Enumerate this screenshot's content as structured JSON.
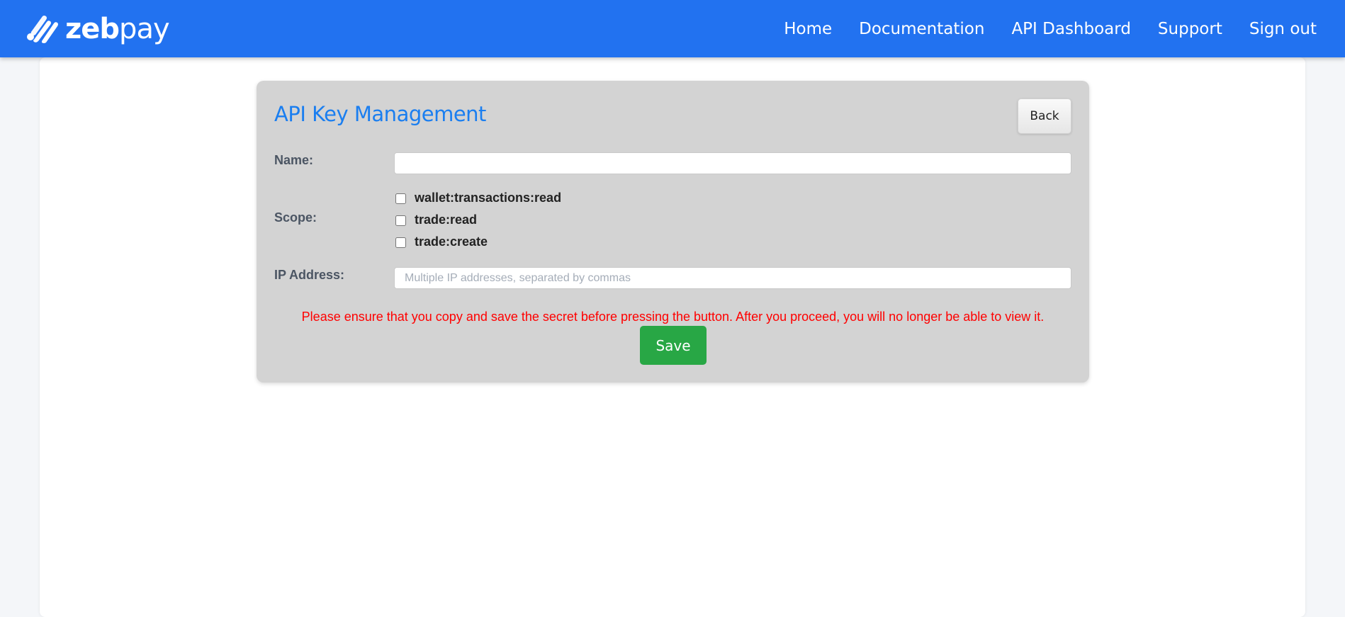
{
  "brand": {
    "name_bold": "zeb",
    "name_light": "pay",
    "logo_icon": "zebpay-stripes-icon"
  },
  "nav": {
    "items": [
      {
        "label": "Home"
      },
      {
        "label": "Documentation"
      },
      {
        "label": "API Dashboard"
      },
      {
        "label": "Support"
      },
      {
        "label": "Sign out"
      }
    ]
  },
  "card": {
    "title": "API Key Management",
    "back_label": "Back",
    "name_label": "Name:",
    "name_value": "",
    "scope_label": "Scope:",
    "scopes": [
      {
        "label": "wallet:transactions:read",
        "checked": false
      },
      {
        "label": "trade:read",
        "checked": false
      },
      {
        "label": "trade:create",
        "checked": false
      }
    ],
    "ip_label": "IP Address:",
    "ip_placeholder": "Multiple IP addresses, separated by commas",
    "warning": "Please ensure that you copy and save the secret before pressing the button. After you proceed, you will no longer be able to view it.",
    "save_label": "Save"
  },
  "colors": {
    "navbar": "#2272f0",
    "title": "#1a7ef0",
    "warning": "#ff0000",
    "save": "#28a745",
    "card_bg": "#d3d3d3"
  }
}
